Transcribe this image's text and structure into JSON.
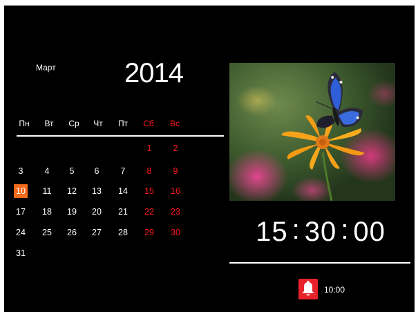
{
  "calendar": {
    "month": "Март",
    "year": "2014",
    "weekdays": [
      {
        "label": "Пн",
        "weekend": false
      },
      {
        "label": "Вт",
        "weekend": false
      },
      {
        "label": "Ср",
        "weekend": false
      },
      {
        "label": "Чт",
        "weekend": false
      },
      {
        "label": "Пт",
        "weekend": false
      },
      {
        "label": "Сб",
        "weekend": true
      },
      {
        "label": "Вс",
        "weekend": true
      }
    ],
    "first_weekday_index": 5,
    "days_in_month": 31,
    "today": 10
  },
  "photo": {
    "subject": "butterfly on orange flower"
  },
  "clock": {
    "hours": "15",
    "minutes": "30",
    "seconds": "00",
    "separator": ":"
  },
  "alarm": {
    "icon": "bell-icon",
    "time": "10:00"
  },
  "colors": {
    "weekend": "#ff1a1a",
    "today_highlight": "#f26a1b",
    "alarm_badge": "#e8222a",
    "background": "#000000"
  }
}
